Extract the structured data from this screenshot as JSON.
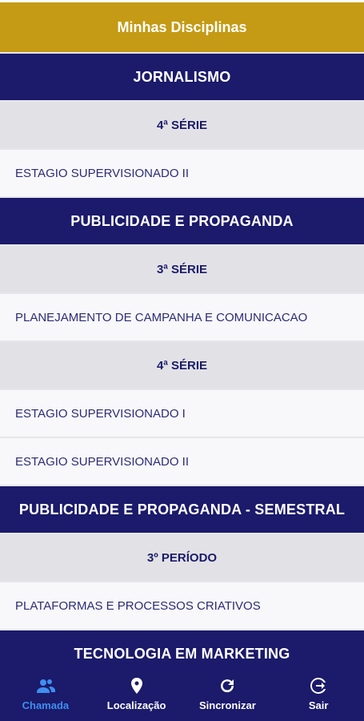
{
  "header": {
    "title": "Minhas Disciplinas"
  },
  "courses": [
    {
      "name": "JORNALISMO",
      "groups": [
        {
          "serie": "4ª SÉRIE",
          "subjects": [
            "ESTAGIO SUPERVISIONADO II"
          ]
        }
      ]
    },
    {
      "name": "PUBLICIDADE E PROPAGANDA",
      "groups": [
        {
          "serie": "3ª SÉRIE",
          "subjects": [
            "PLANEJAMENTO DE CAMPANHA E COMUNICACAO"
          ]
        },
        {
          "serie": "4ª SÉRIE",
          "subjects": [
            "ESTAGIO SUPERVISIONADO I",
            "ESTAGIO SUPERVISIONADO II"
          ]
        }
      ]
    },
    {
      "name": "PUBLICIDADE E PROPAGANDA - SEMESTRAL",
      "groups": [
        {
          "serie": "3º PERÍODO",
          "subjects": [
            "PLATAFORMAS E PROCESSOS CRIATIVOS"
          ]
        }
      ]
    },
    {
      "name": "TECNOLOGIA EM MARKETING",
      "groups": []
    }
  ],
  "nav": {
    "items": [
      {
        "label": "Chamada",
        "icon": "people-icon",
        "active": true
      },
      {
        "label": "Localização",
        "icon": "location-pin-icon",
        "active": false
      },
      {
        "label": "Sincronizar",
        "icon": "refresh-icon",
        "active": false
      },
      {
        "label": "Sair",
        "icon": "logout-icon",
        "active": false
      }
    ]
  },
  "colors": {
    "header": "#c59a14",
    "course_band": "#1b1a6b",
    "serie_band": "#e2e2e6",
    "active_nav": "#3f8ef0"
  }
}
